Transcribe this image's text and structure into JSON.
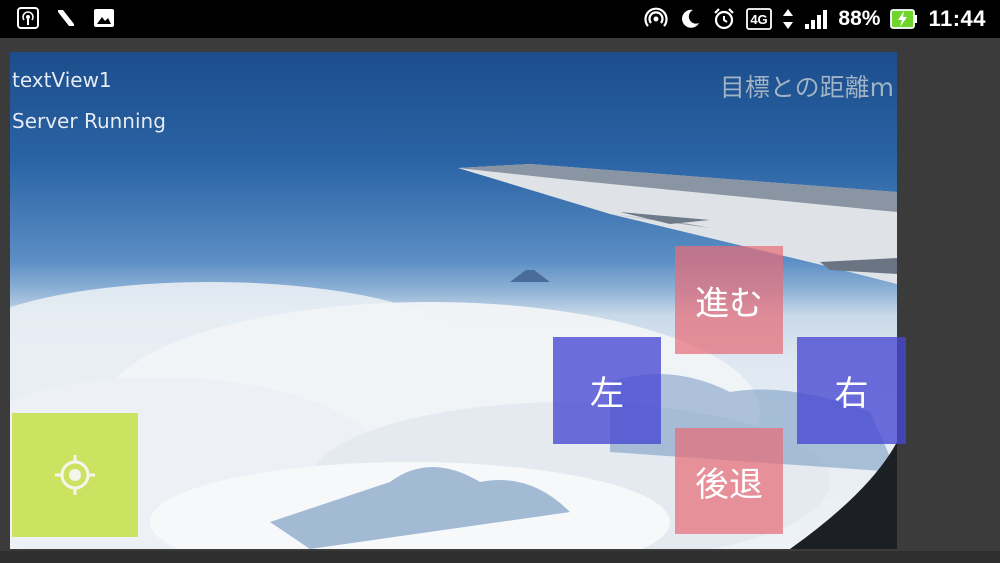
{
  "status_bar": {
    "left_icons": [
      "hotspot-icon",
      "notification-n-icon",
      "image-icon"
    ],
    "network_label": "4G",
    "battery_percent": "88%",
    "time": "11:44"
  },
  "overlay": {
    "text_view": "textView1",
    "server_status": "Server Running",
    "distance_label": "目標との距離m"
  },
  "controls": {
    "forward": "進む",
    "back": "後退",
    "left": "左",
    "right": "右",
    "locate_icon": "crosshair-icon"
  },
  "colors": {
    "forward_back": "#e66e78",
    "left_right": "#4646d2",
    "locate": "#c6e146"
  }
}
